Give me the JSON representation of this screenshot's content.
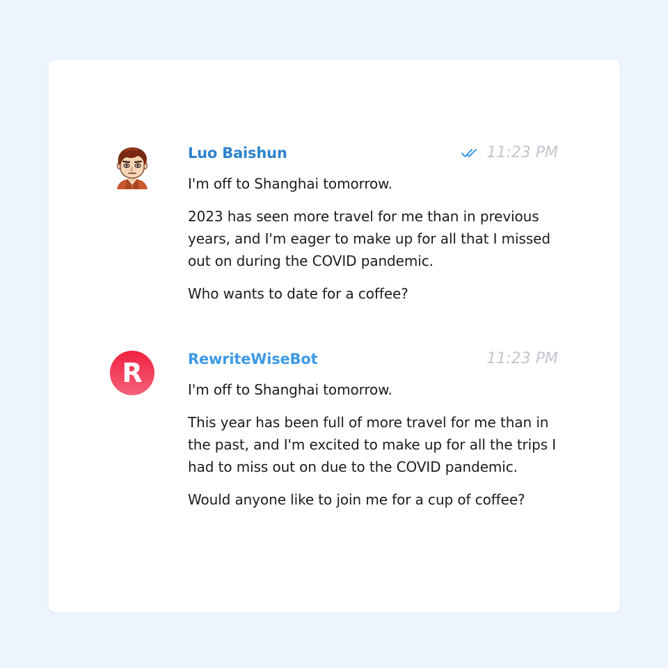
{
  "messages": [
    {
      "author": "Luo Baishun",
      "time": "11:23 PM",
      "read_status_icon": "double-check-icon",
      "avatar_icon": "cartoon-man-avatar",
      "paragraphs": [
        "I'm off to Shanghai tomorrow.",
        "2023 has seen more travel for me than in previous years, and I'm eager to make up for all that I missed out on during the COVID pandemic.",
        "Who wants to date for a coffee?"
      ]
    },
    {
      "author": "RewriteWiseBot",
      "time": "11:23 PM",
      "avatar_letter": "R",
      "paragraphs": [
        "I'm off to Shanghai tomorrow.",
        "This year has been full of more travel for me than in the past, and I'm excited to make up for all the trips I had to miss out on due to the COVID pandemic.",
        "Would anyone like to join me for a cup of coffee?"
      ]
    }
  ],
  "colors": {
    "background": "#eef4fd",
    "card": "#ffffff",
    "user_name": "#2e83cc",
    "bot_name": "#3d9ae6",
    "timestamp": "#c2c6cc",
    "check": "#3d9ae6",
    "bot_avatar_top": "#f0203f",
    "bot_avatar_bottom": "#f5607a",
    "text": "#1b1b1b"
  }
}
